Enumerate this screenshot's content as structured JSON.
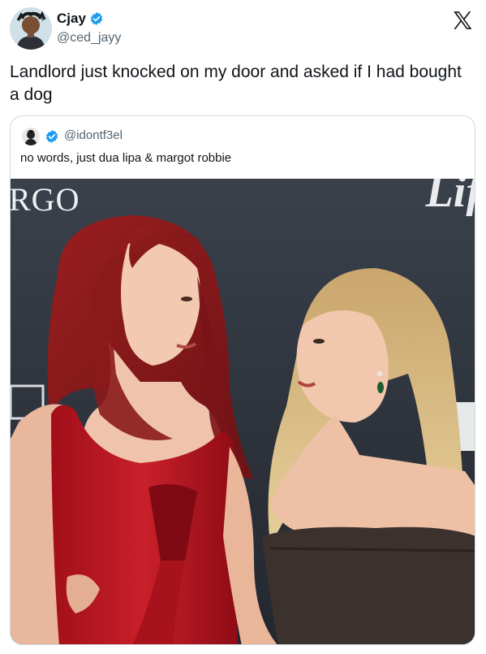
{
  "author": {
    "name": "Cjay",
    "handle": "@ced_jayy",
    "verified": true
  },
  "tweet": {
    "text": "Landlord just knocked on my door and asked if I had bought a dog"
  },
  "quoted_tweet": {
    "handle": "@idontf3el",
    "verified": true,
    "text": "no words, just dua lipa & margot robbie",
    "media": {
      "left_backdrop_text": "RGO",
      "right_backdrop_text": "Lif"
    }
  },
  "icons": {
    "platform": "x-logo-icon",
    "verified": "verified-badge-icon"
  },
  "colors": {
    "verified_blue": "#1d9bf0",
    "handle_gray": "#536471",
    "border": "#cfd9de",
    "backdrop": "#2b3038",
    "red_dress": "#b0121c",
    "dark_dress": "#3b312d"
  }
}
